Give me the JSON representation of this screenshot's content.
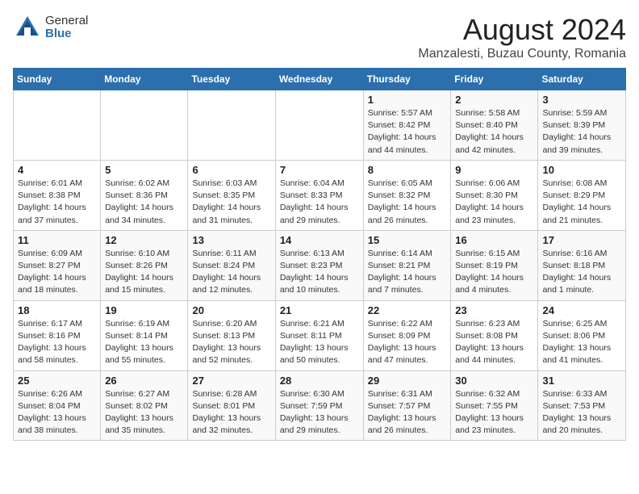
{
  "logo": {
    "general": "General",
    "blue": "Blue"
  },
  "title": "August 2024",
  "subtitle": "Manzalesti, Buzau County, Romania",
  "headers": [
    "Sunday",
    "Monday",
    "Tuesday",
    "Wednesday",
    "Thursday",
    "Friday",
    "Saturday"
  ],
  "weeks": [
    [
      {
        "day": "",
        "info": ""
      },
      {
        "day": "",
        "info": ""
      },
      {
        "day": "",
        "info": ""
      },
      {
        "day": "",
        "info": ""
      },
      {
        "day": "1",
        "info": "Sunrise: 5:57 AM\nSunset: 8:42 PM\nDaylight: 14 hours\nand 44 minutes."
      },
      {
        "day": "2",
        "info": "Sunrise: 5:58 AM\nSunset: 8:40 PM\nDaylight: 14 hours\nand 42 minutes."
      },
      {
        "day": "3",
        "info": "Sunrise: 5:59 AM\nSunset: 8:39 PM\nDaylight: 14 hours\nand 39 minutes."
      }
    ],
    [
      {
        "day": "4",
        "info": "Sunrise: 6:01 AM\nSunset: 8:38 PM\nDaylight: 14 hours\nand 37 minutes."
      },
      {
        "day": "5",
        "info": "Sunrise: 6:02 AM\nSunset: 8:36 PM\nDaylight: 14 hours\nand 34 minutes."
      },
      {
        "day": "6",
        "info": "Sunrise: 6:03 AM\nSunset: 8:35 PM\nDaylight: 14 hours\nand 31 minutes."
      },
      {
        "day": "7",
        "info": "Sunrise: 6:04 AM\nSunset: 8:33 PM\nDaylight: 14 hours\nand 29 minutes."
      },
      {
        "day": "8",
        "info": "Sunrise: 6:05 AM\nSunset: 8:32 PM\nDaylight: 14 hours\nand 26 minutes."
      },
      {
        "day": "9",
        "info": "Sunrise: 6:06 AM\nSunset: 8:30 PM\nDaylight: 14 hours\nand 23 minutes."
      },
      {
        "day": "10",
        "info": "Sunrise: 6:08 AM\nSunset: 8:29 PM\nDaylight: 14 hours\nand 21 minutes."
      }
    ],
    [
      {
        "day": "11",
        "info": "Sunrise: 6:09 AM\nSunset: 8:27 PM\nDaylight: 14 hours\nand 18 minutes."
      },
      {
        "day": "12",
        "info": "Sunrise: 6:10 AM\nSunset: 8:26 PM\nDaylight: 14 hours\nand 15 minutes."
      },
      {
        "day": "13",
        "info": "Sunrise: 6:11 AM\nSunset: 8:24 PM\nDaylight: 14 hours\nand 12 minutes."
      },
      {
        "day": "14",
        "info": "Sunrise: 6:13 AM\nSunset: 8:23 PM\nDaylight: 14 hours\nand 10 minutes."
      },
      {
        "day": "15",
        "info": "Sunrise: 6:14 AM\nSunset: 8:21 PM\nDaylight: 14 hours\nand 7 minutes."
      },
      {
        "day": "16",
        "info": "Sunrise: 6:15 AM\nSunset: 8:19 PM\nDaylight: 14 hours\nand 4 minutes."
      },
      {
        "day": "17",
        "info": "Sunrise: 6:16 AM\nSunset: 8:18 PM\nDaylight: 14 hours\nand 1 minute."
      }
    ],
    [
      {
        "day": "18",
        "info": "Sunrise: 6:17 AM\nSunset: 8:16 PM\nDaylight: 13 hours\nand 58 minutes."
      },
      {
        "day": "19",
        "info": "Sunrise: 6:19 AM\nSunset: 8:14 PM\nDaylight: 13 hours\nand 55 minutes."
      },
      {
        "day": "20",
        "info": "Sunrise: 6:20 AM\nSunset: 8:13 PM\nDaylight: 13 hours\nand 52 minutes."
      },
      {
        "day": "21",
        "info": "Sunrise: 6:21 AM\nSunset: 8:11 PM\nDaylight: 13 hours\nand 50 minutes."
      },
      {
        "day": "22",
        "info": "Sunrise: 6:22 AM\nSunset: 8:09 PM\nDaylight: 13 hours\nand 47 minutes."
      },
      {
        "day": "23",
        "info": "Sunrise: 6:23 AM\nSunset: 8:08 PM\nDaylight: 13 hours\nand 44 minutes."
      },
      {
        "day": "24",
        "info": "Sunrise: 6:25 AM\nSunset: 8:06 PM\nDaylight: 13 hours\nand 41 minutes."
      }
    ],
    [
      {
        "day": "25",
        "info": "Sunrise: 6:26 AM\nSunset: 8:04 PM\nDaylight: 13 hours\nand 38 minutes."
      },
      {
        "day": "26",
        "info": "Sunrise: 6:27 AM\nSunset: 8:02 PM\nDaylight: 13 hours\nand 35 minutes."
      },
      {
        "day": "27",
        "info": "Sunrise: 6:28 AM\nSunset: 8:01 PM\nDaylight: 13 hours\nand 32 minutes."
      },
      {
        "day": "28",
        "info": "Sunrise: 6:30 AM\nSunset: 7:59 PM\nDaylight: 13 hours\nand 29 minutes."
      },
      {
        "day": "29",
        "info": "Sunrise: 6:31 AM\nSunset: 7:57 PM\nDaylight: 13 hours\nand 26 minutes."
      },
      {
        "day": "30",
        "info": "Sunrise: 6:32 AM\nSunset: 7:55 PM\nDaylight: 13 hours\nand 23 minutes."
      },
      {
        "day": "31",
        "info": "Sunrise: 6:33 AM\nSunset: 7:53 PM\nDaylight: 13 hours\nand 20 minutes."
      }
    ]
  ]
}
